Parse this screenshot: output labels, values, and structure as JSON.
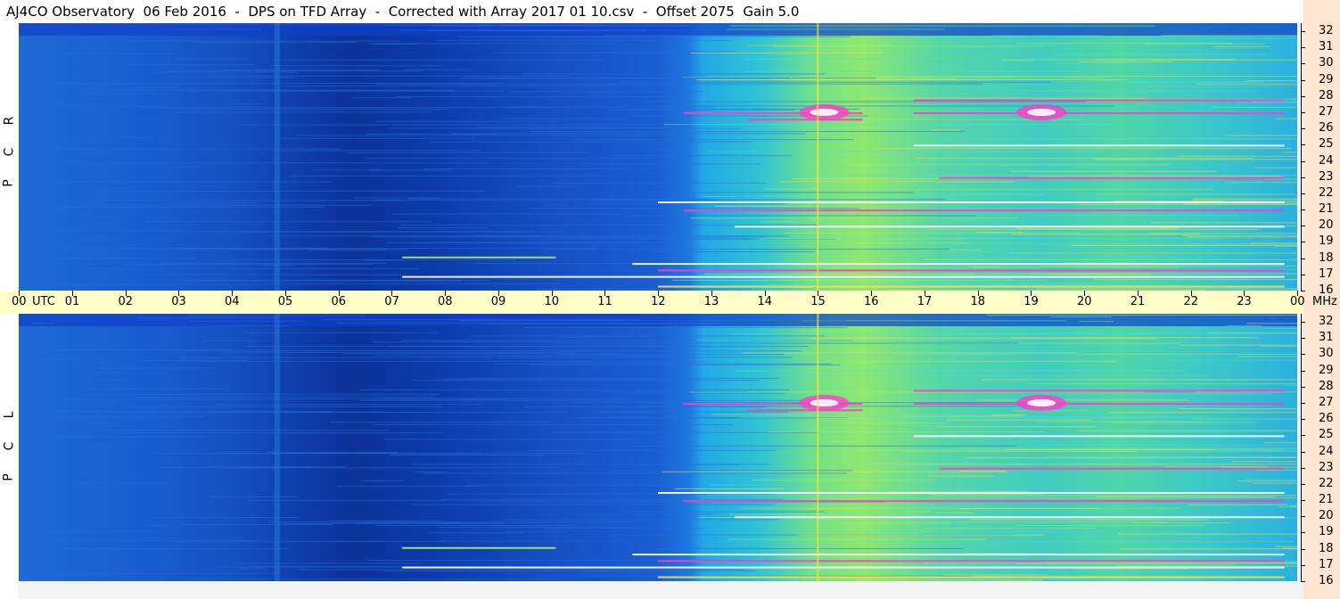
{
  "title": "AJ4CO Observatory  06 Feb 2016  -  DPS on TFD Array  -  Corrected with Array 2017 01 10.csv  -  Offset 2075  Gain 5.0",
  "chart_data": {
    "type": "heatmap",
    "title": "AJ4CO Observatory  06 Feb 2016  -  DPS on TFD Array  -  Corrected with Array 2017 01 10.csv  -  Offset 2075  Gain 5.0",
    "x_ticks": [
      "00",
      "01",
      "02",
      "03",
      "04",
      "05",
      "06",
      "07",
      "08",
      "09",
      "10",
      "11",
      "12",
      "13",
      "14",
      "15",
      "16",
      "17",
      "18",
      "19",
      "20",
      "21",
      "22",
      "23",
      "00"
    ],
    "x_unit": "UTC",
    "y_unit": "MHz",
    "y_ticks": [
      32,
      31,
      30,
      29,
      28,
      27,
      26,
      25,
      24,
      23,
      22,
      21,
      20,
      19,
      18,
      17,
      16
    ],
    "xlim": [
      0,
      24
    ],
    "ylim": [
      16,
      32.5
    ],
    "panels": [
      {
        "name": "RCP",
        "label_letters": [
          "R",
          "C",
          "P"
        ]
      },
      {
        "name": "LCP",
        "label_letters": [
          "L",
          "C",
          "P"
        ]
      }
    ],
    "colormap": [
      "#0a1f80",
      "#1040c8",
      "#1e73e0",
      "#22b4e6",
      "#3cd0c0",
      "#a8ee60",
      "#ffe040",
      "#ff3cc8",
      "#ffffff"
    ]
  }
}
